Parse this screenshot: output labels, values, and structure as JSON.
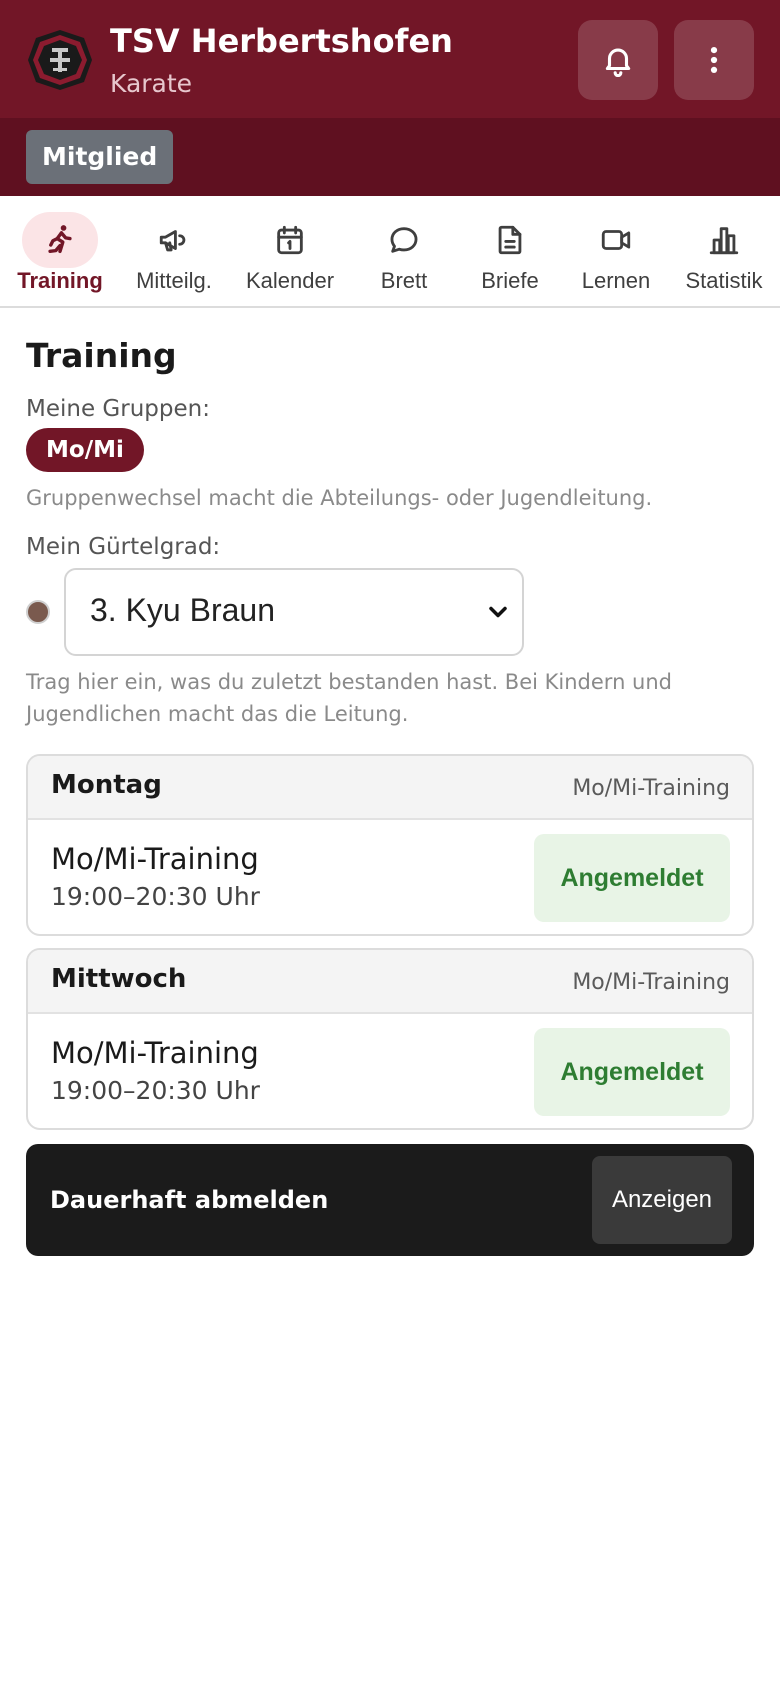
{
  "app": {
    "title": "TSV Herbertshofen",
    "subtitle": "Karate",
    "role": "Mitglied",
    "logo_icon": "club-crest-icon",
    "actions": [
      {
        "icon": "bell-icon"
      },
      {
        "icon": "more-vertical-icon"
      }
    ]
  },
  "colors": {
    "brand": "#721627",
    "brand_dark": "#5f1020",
    "success": "#2e7d32",
    "belt_brown": "#7a5a4e"
  },
  "tabs": [
    {
      "label": "Training",
      "icon": "running-icon",
      "active": true
    },
    {
      "label": "Mitteilg.",
      "icon": "megaphone-icon",
      "active": false
    },
    {
      "label": "Kalender",
      "icon": "calendar-icon",
      "active": false
    },
    {
      "label": "Brett",
      "icon": "chat-bubble-icon",
      "active": false
    },
    {
      "label": "Briefe",
      "icon": "document-icon",
      "active": false
    },
    {
      "label": "Lernen",
      "icon": "video-icon",
      "active": false
    },
    {
      "label": "Statistik",
      "icon": "bar-chart-icon",
      "active": false
    }
  ],
  "main": {
    "title": "Training",
    "groups_label": "Meine Gruppen:",
    "group_chip": "Mo/Mi",
    "groups_hint": "Gruppenwechsel macht die Abteilungs- oder Jugendleitung.",
    "belt_label": "Mein Gürtelgrad:",
    "belt_value": "3. Kyu Braun",
    "belt_hint": "Trag hier ein, was du zuletzt bestanden hast. Bei Kindern und Jugendlichen macht das die Leitung."
  },
  "sessions": [
    {
      "day": "Montag",
      "tag": "Mo/Mi-Training",
      "name": "Mo/Mi-Training",
      "time": "19:00–20:30 Uhr",
      "status": "Angemeldet"
    },
    {
      "day": "Mittwoch",
      "tag": "Mo/Mi-Training",
      "name": "Mo/Mi-Training",
      "time": "19:00–20:30 Uhr",
      "status": "Angemeldet"
    }
  ],
  "unsubscribe": {
    "label": "Dauerhaft abmelden",
    "button": "Anzeigen"
  }
}
